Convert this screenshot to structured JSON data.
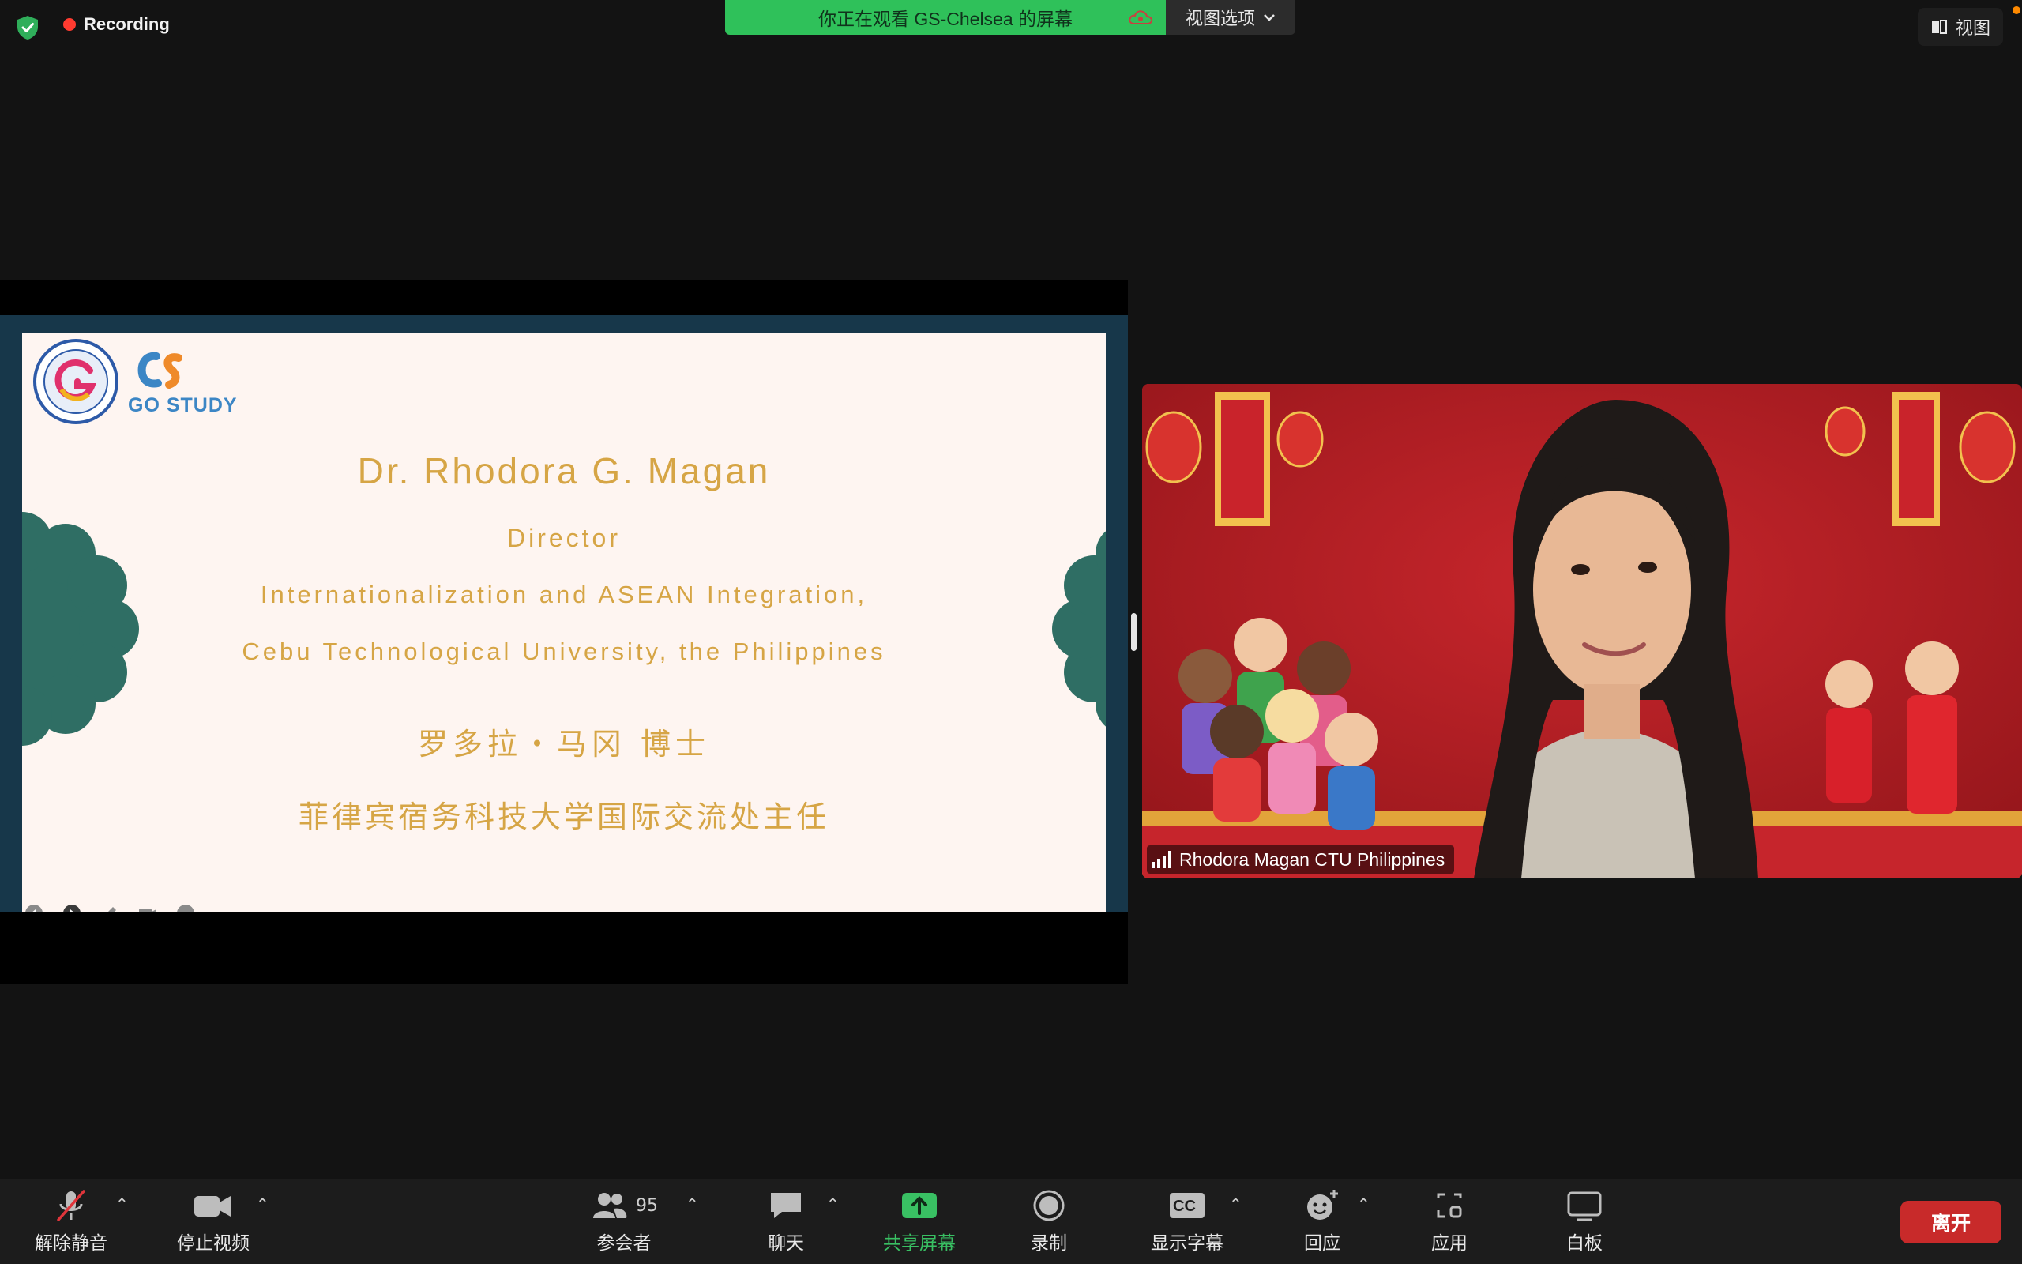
{
  "top_bar": {
    "recording_label": "Recording",
    "viewing_banner": "你正在观看 GS-Chelsea 的屏幕",
    "view_options_label": "视图选项",
    "view_button_label": "视图"
  },
  "slide": {
    "logo_text": "GO STUDY",
    "name": "Dr. Rhodora G. Magan",
    "title": "Director",
    "line2": "Internationalization and ASEAN Integration,",
    "line3": "Cebu Technological University, the Philippines",
    "cn_name": "罗多拉・马冈 博士",
    "cn_title": "菲律宾宿务科技大学国际交流处主任"
  },
  "video": {
    "participant_name": "Rhodora Magan CTU Philippines"
  },
  "toolbar": {
    "unmute": "解除静音",
    "stop_video": "停止视频",
    "participants": "参会者",
    "participants_count": "95",
    "chat": "聊天",
    "share_screen": "共享屏幕",
    "record": "录制",
    "captions": "显示字幕",
    "captions_badge": "CC",
    "reactions": "回应",
    "apps": "应用",
    "whiteboard": "白板",
    "leave": "离开"
  },
  "colors": {
    "share_green": "#2fc15a",
    "slide_gold": "#d6a545",
    "leave_red": "#c82a2a",
    "recording_red": "#ff3b30"
  }
}
